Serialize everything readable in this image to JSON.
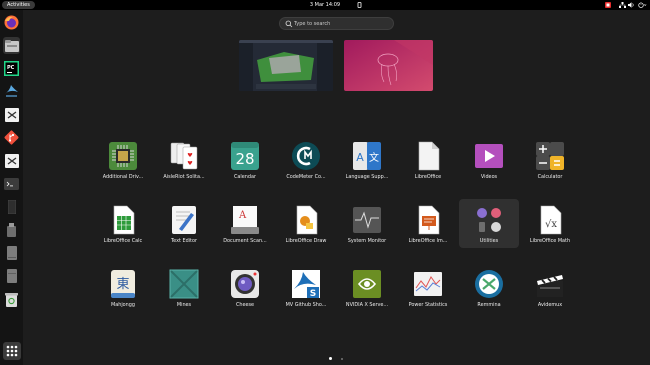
{
  "topbar": {
    "activities": "Activities",
    "clock": "3 Mar  14:09"
  },
  "search": {
    "placeholder": "Type to search"
  },
  "dock": {
    "items": [
      "Firefox",
      "Files",
      "PyCharm",
      "Wireshark",
      "Remmina",
      "Git",
      "Remmina",
      "Terminal",
      "Drive",
      "USB Drive",
      "Drive",
      "Drive",
      "Trash"
    ],
    "show_apps": "Show Applications"
  },
  "apps": [
    {
      "label": "Additional Driv...",
      "icon": "chip-icon"
    },
    {
      "label": "AisleRiot Solita...",
      "icon": "cards-icon"
    },
    {
      "label": "Calendar",
      "icon": "calendar-icon",
      "text": "28"
    },
    {
      "label": "CodeMeter Co...",
      "icon": "codemeter-icon"
    },
    {
      "label": "Language Supp...",
      "icon": "language-icon",
      "text_a": "A",
      "text_b": "文"
    },
    {
      "label": "LibreOffice",
      "icon": "document-icon"
    },
    {
      "label": "Videos",
      "icon": "play-icon"
    },
    {
      "label": "Calculator",
      "icon": "calculator-icon"
    },
    {
      "label": "LibreOffice Calc",
      "icon": "spreadsheet-icon"
    },
    {
      "label": "Text Editor",
      "icon": "text-editor-icon"
    },
    {
      "label": "Document Scan...",
      "icon": "scanner-icon",
      "text": "A"
    },
    {
      "label": "LibreOffice Draw",
      "icon": "draw-icon"
    },
    {
      "label": "System Monitor",
      "icon": "monitor-icon"
    },
    {
      "label": "LibreOffice Im...",
      "icon": "impress-icon"
    },
    {
      "label": "Utilities",
      "icon": "folder-icon"
    },
    {
      "label": "LibreOffice Math",
      "icon": "math-icon",
      "text": "√x"
    },
    {
      "label": "Mahjongg",
      "icon": "mahjongg-icon",
      "text": "東"
    },
    {
      "label": "Mines",
      "icon": "mines-icon"
    },
    {
      "label": "Cheese",
      "icon": "camera-icon"
    },
    {
      "label": "MV Github Sho...",
      "icon": "matlab-icon",
      "text": "S"
    },
    {
      "label": "NVIDIA X Serve...",
      "icon": "nvidia-icon"
    },
    {
      "label": "Power Statistics",
      "icon": "power-stats-icon"
    },
    {
      "label": "Remmina",
      "icon": "remmina-icon"
    },
    {
      "label": "Avidemux",
      "icon": "clapper-icon"
    }
  ],
  "pages": {
    "current": 1,
    "total": 2
  },
  "colors": {
    "background": "#1d1d1d",
    "dock": "#141414",
    "accent": "#e95420"
  }
}
